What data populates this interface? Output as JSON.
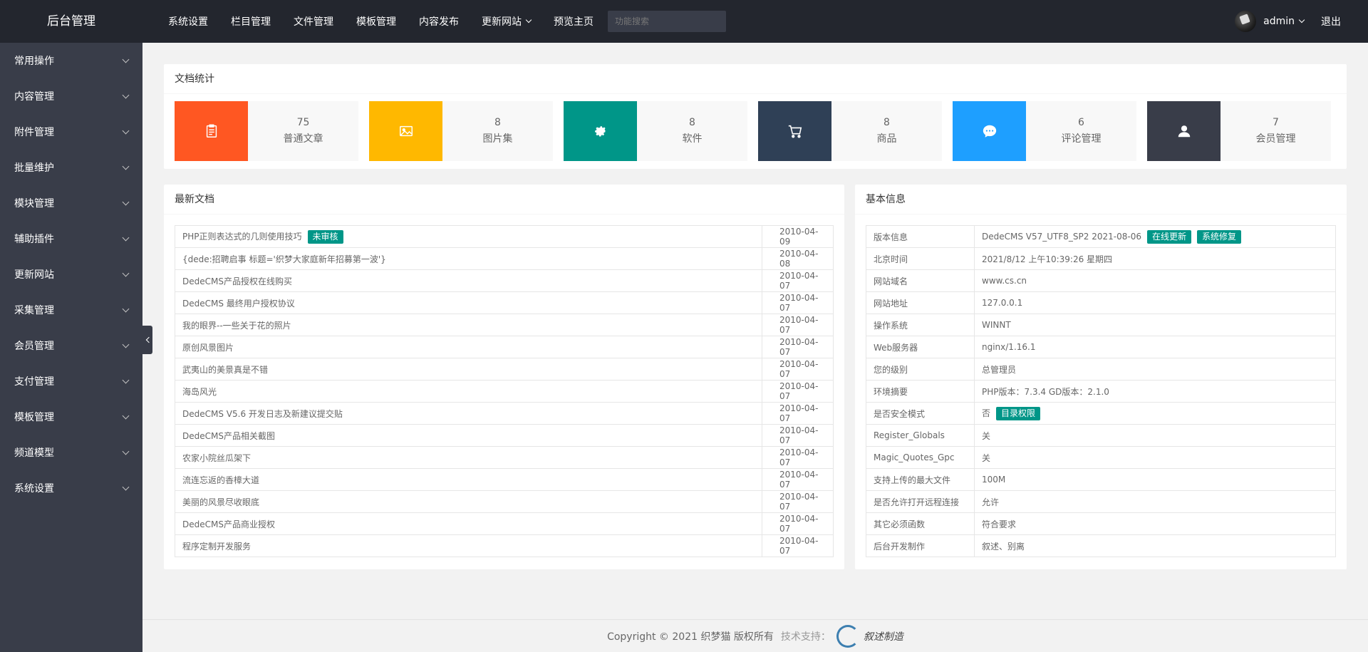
{
  "sidebar": {
    "title": "后台管理",
    "items": [
      {
        "label": "常用操作"
      },
      {
        "label": "内容管理"
      },
      {
        "label": "附件管理"
      },
      {
        "label": "批量维护"
      },
      {
        "label": "模块管理"
      },
      {
        "label": "辅助插件"
      },
      {
        "label": "更新网站"
      },
      {
        "label": "采集管理"
      },
      {
        "label": "会员管理"
      },
      {
        "label": "支付管理"
      },
      {
        "label": "模板管理"
      },
      {
        "label": "频道模型"
      },
      {
        "label": "系统设置"
      }
    ]
  },
  "header": {
    "nav": [
      {
        "label": "系统设置"
      },
      {
        "label": "栏目管理"
      },
      {
        "label": "文件管理"
      },
      {
        "label": "模板管理"
      },
      {
        "label": "内容发布"
      },
      {
        "label": "更新网站"
      },
      {
        "label": "预览主页"
      }
    ],
    "search_placeholder": "功能搜索",
    "user": "admin",
    "logout": "退出"
  },
  "stats": {
    "title": "文档统计",
    "items": [
      {
        "value": "75",
        "label": "普通文章",
        "color": "#ff5722",
        "icon": "clipboard-icon"
      },
      {
        "value": "8",
        "label": "图片集",
        "color": "#ffb800",
        "icon": "image-icon"
      },
      {
        "value": "8",
        "label": "软件",
        "color": "#009688",
        "icon": "gear-icon"
      },
      {
        "value": "8",
        "label": "商品",
        "color": "#2f4056",
        "icon": "cart-icon"
      },
      {
        "value": "6",
        "label": "评论管理",
        "color": "#1e9fff",
        "icon": "chat-icon"
      },
      {
        "value": "7",
        "label": "会员管理",
        "color": "#393d49",
        "icon": "user-icon"
      }
    ]
  },
  "latest": {
    "title": "最新文档",
    "rows": [
      {
        "title": "PHP正则表达式的几则使用技巧",
        "badge": "未审核",
        "date": "2010-04-09"
      },
      {
        "title": "{dede:招聘启事 标题='织梦大家庭新年招募第一波'}",
        "date": "2010-04-08"
      },
      {
        "title": "DedeCMS产品授权在线购买",
        "date": "2010-04-07"
      },
      {
        "title": "DedeCMS 最终用户授权协议",
        "date": "2010-04-07"
      },
      {
        "title": "我的眼界--一些关于花的照片",
        "date": "2010-04-07"
      },
      {
        "title": "原创风景图片",
        "date": "2010-04-07"
      },
      {
        "title": "武夷山的美景真是不错",
        "date": "2010-04-07"
      },
      {
        "title": "海岛风光",
        "date": "2010-04-07"
      },
      {
        "title": "DedeCMS V5.6 开发日志及新建议提交贴",
        "date": "2010-04-07"
      },
      {
        "title": "DedeCMS产品相关截图",
        "date": "2010-04-07"
      },
      {
        "title": "农家小院丝瓜架下",
        "date": "2010-04-07"
      },
      {
        "title": "流连忘返的香樟大道",
        "date": "2010-04-07"
      },
      {
        "title": "美丽的风景尽收眼底",
        "date": "2010-04-07"
      },
      {
        "title": "DedeCMS产品商业授权",
        "date": "2010-04-07"
      },
      {
        "title": "程序定制开发服务",
        "date": "2010-04-07"
      }
    ]
  },
  "info": {
    "title": "基本信息",
    "rows": [
      {
        "label": "版本信息",
        "value": "DedeCMS V57_UTF8_SP2 2021-08-06",
        "badges": [
          "在线更新",
          "系统修复"
        ]
      },
      {
        "label": "北京时间",
        "value": "2021/8/12 上午10:39:26 星期四"
      },
      {
        "label": "网站域名",
        "value": "www.cs.cn"
      },
      {
        "label": "网站地址",
        "value": "127.0.0.1"
      },
      {
        "label": "操作系统",
        "value": "WINNT"
      },
      {
        "label": "Web服务器",
        "value": "nginx/1.16.1"
      },
      {
        "label": "您的级别",
        "value": "总管理员"
      },
      {
        "label": "环境摘要",
        "value": "PHP版本：7.3.4 GD版本：2.1.0"
      },
      {
        "label": "是否安全模式",
        "value": "否",
        "badges": [
          "目录权限"
        ]
      },
      {
        "label": "Register_Globals",
        "value": "关"
      },
      {
        "label": "Magic_Quotes_Gpc",
        "value": "关"
      },
      {
        "label": "支持上传的最大文件",
        "value": "100M"
      },
      {
        "label": "是否允许打开远程连接",
        "value": "允许"
      },
      {
        "label": "其它必须函数",
        "value": "符合要求"
      },
      {
        "label": "后台开发制作",
        "value": "叙述、别离"
      }
    ]
  },
  "footer": {
    "copyright": "Copyright © 2021 织梦猫 版权所有",
    "tech": "技术支持：",
    "logo_text": "叙述制造"
  }
}
